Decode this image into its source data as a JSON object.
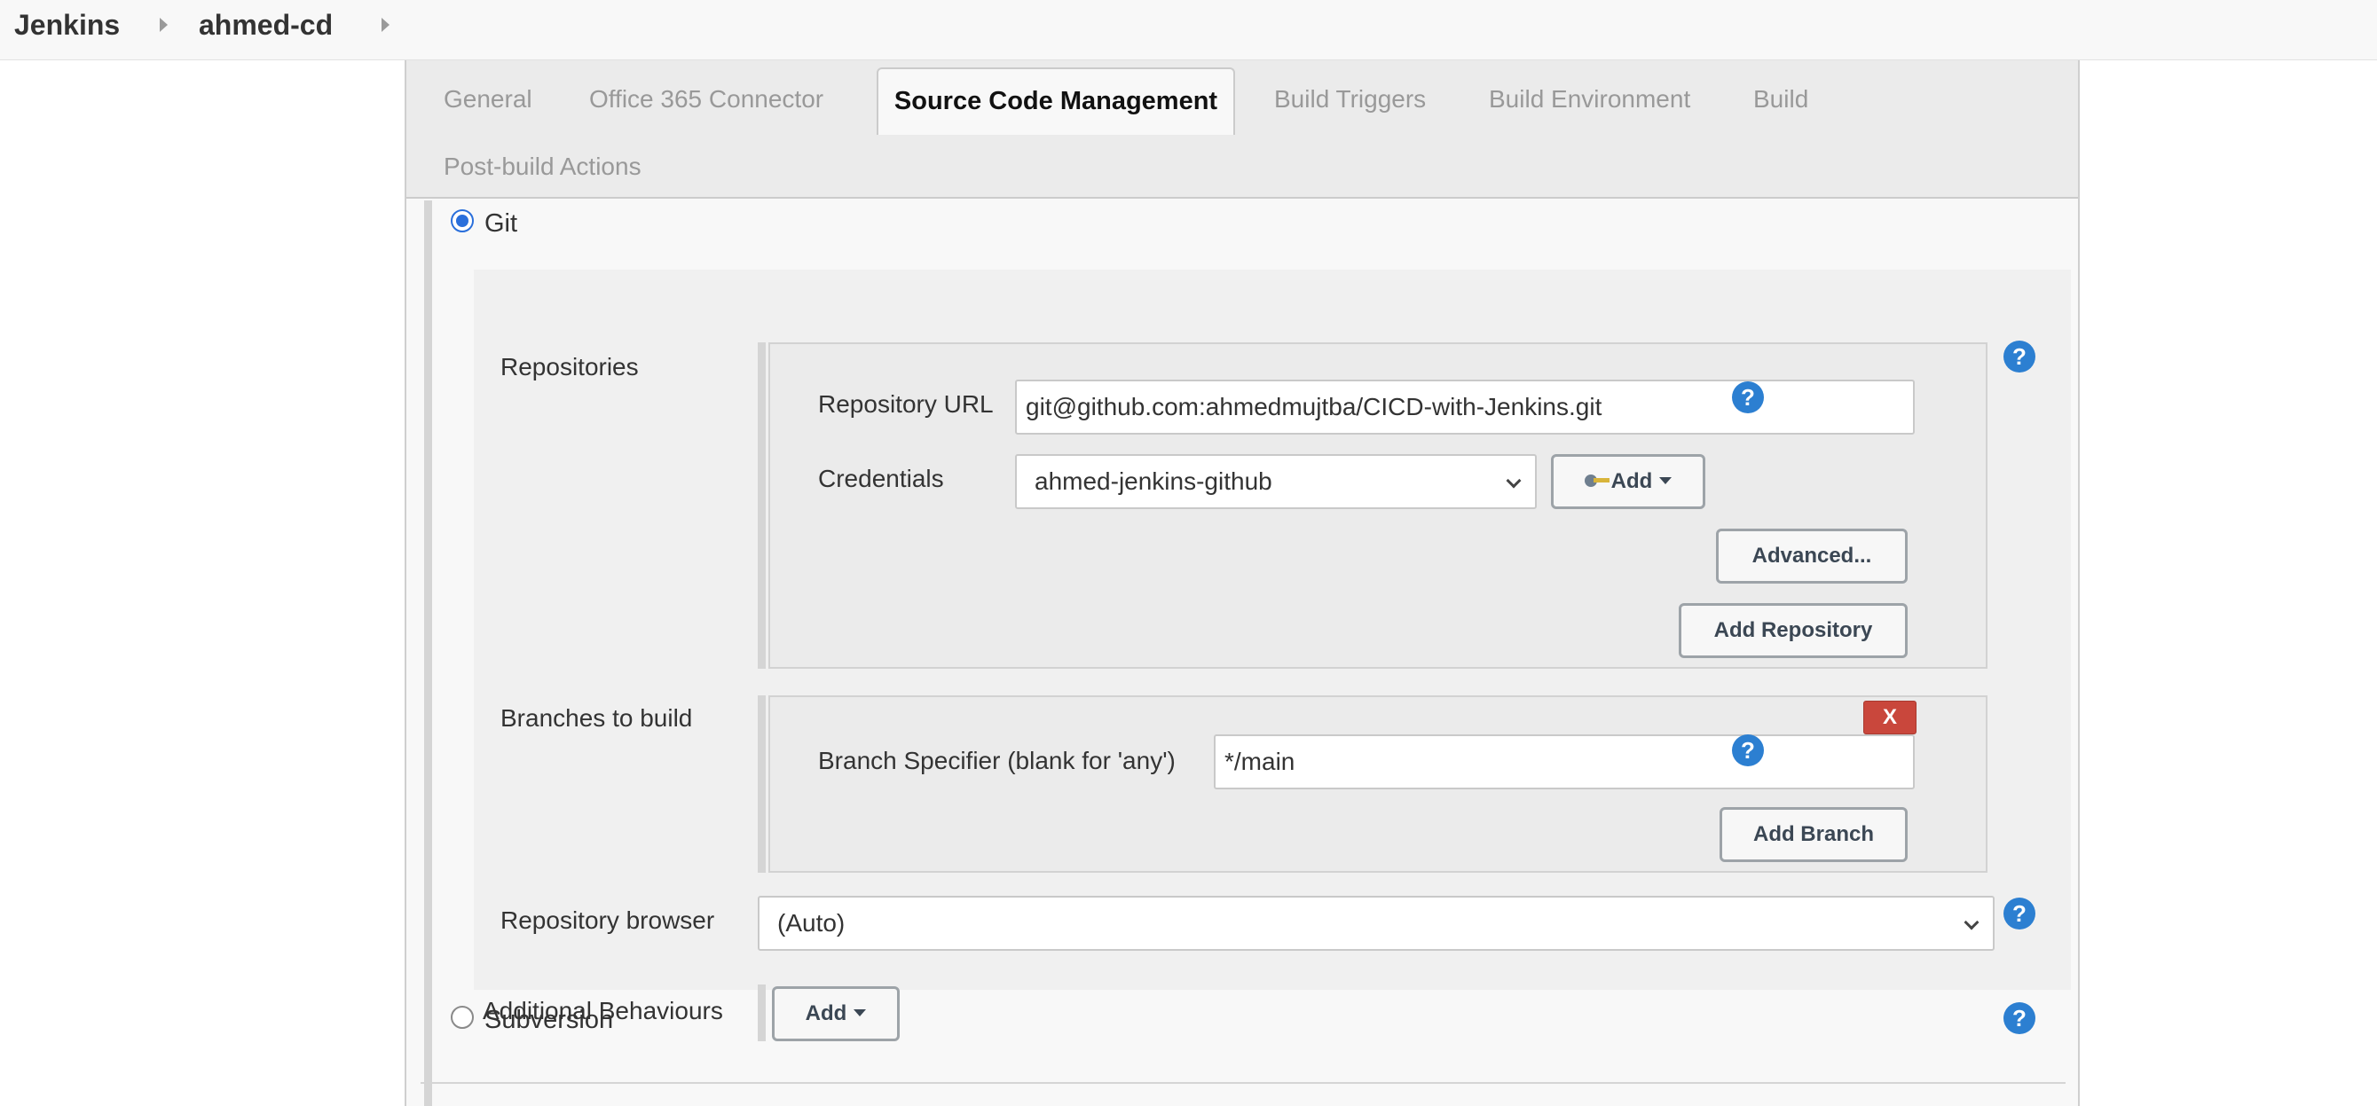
{
  "breadcrumb": {
    "items": [
      "Jenkins",
      "ahmed-cd"
    ]
  },
  "tabs": [
    "General",
    "Office 365 Connector",
    "Source Code Management",
    "Build Triggers",
    "Build Environment",
    "Build",
    "Post-build Actions"
  ],
  "active_tab": "Source Code Management",
  "scm": {
    "git_label": "Git",
    "git_selected": true,
    "repositories_label": "Repositories",
    "repository_url_label": "Repository URL",
    "repository_url_value": "git@github.com:ahmedmujtba/CICD-with-Jenkins.git",
    "credentials_label": "Credentials",
    "credentials_value": "ahmed-jenkins-github",
    "credentials_add_label": "Add",
    "advanced_label": "Advanced...",
    "add_repository_label": "Add Repository",
    "branches_label": "Branches to build",
    "delete_label": "X",
    "branch_specifier_label": "Branch Specifier (blank for 'any')",
    "branch_specifier_value": "*/main",
    "add_branch_label": "Add Branch",
    "repo_browser_label": "Repository browser",
    "repo_browser_value": "(Auto)",
    "additional_behaviours_label": "Additional Behaviours",
    "additional_add_label": "Add",
    "subversion_label": "Subversion",
    "subversion_selected": false,
    "help_symbol": "?"
  },
  "colors": {
    "help": "#2c7fd1",
    "delete": "#c9473c",
    "radio_selected": "#2a6fdb"
  },
  "icons": [
    "chevron-right-icon",
    "help-icon",
    "key-icon",
    "caret-down-icon",
    "chevron-down-icon"
  ]
}
